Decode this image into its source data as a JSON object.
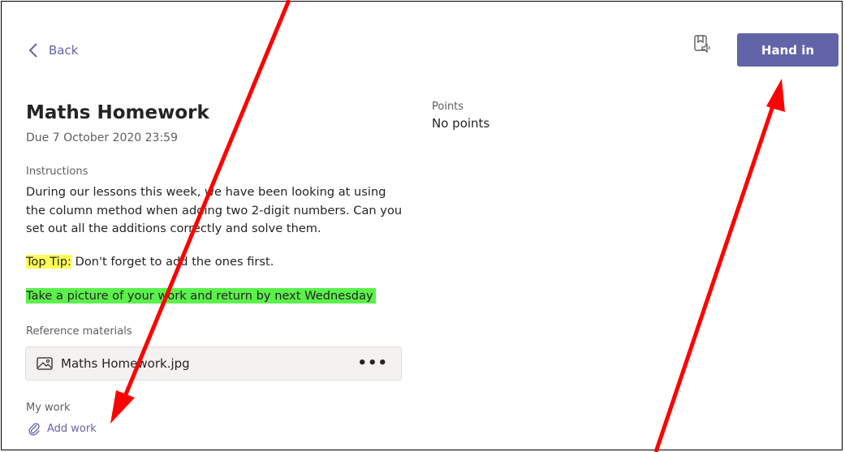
{
  "header": {
    "back_label": "Back",
    "hand_in_label": "Hand in",
    "accent_color": "#6264a7"
  },
  "assignment": {
    "title": "Maths Homework",
    "due": "Due 7 October 2020 23:59",
    "instructions_label": "Instructions",
    "instructions_text": "During our lessons this week, we have been looking at using the column method when adding two 2-digit numbers. Can you set out all the additions correctly and solve them.",
    "tip_label": "Top Tip:",
    "tip_text": " Don't forget to add the ones first.",
    "highlight_text": "Take a picture of your work and return by next Wednesday",
    "points_label": "Points",
    "points_value": "No points"
  },
  "reference": {
    "label": "Reference materials",
    "file_name": "Maths Homework.jpg",
    "more_label": "•••"
  },
  "my_work": {
    "label": "My work",
    "add_label": "Add work"
  },
  "annotations": {
    "arrow_color": "#ff0000"
  }
}
